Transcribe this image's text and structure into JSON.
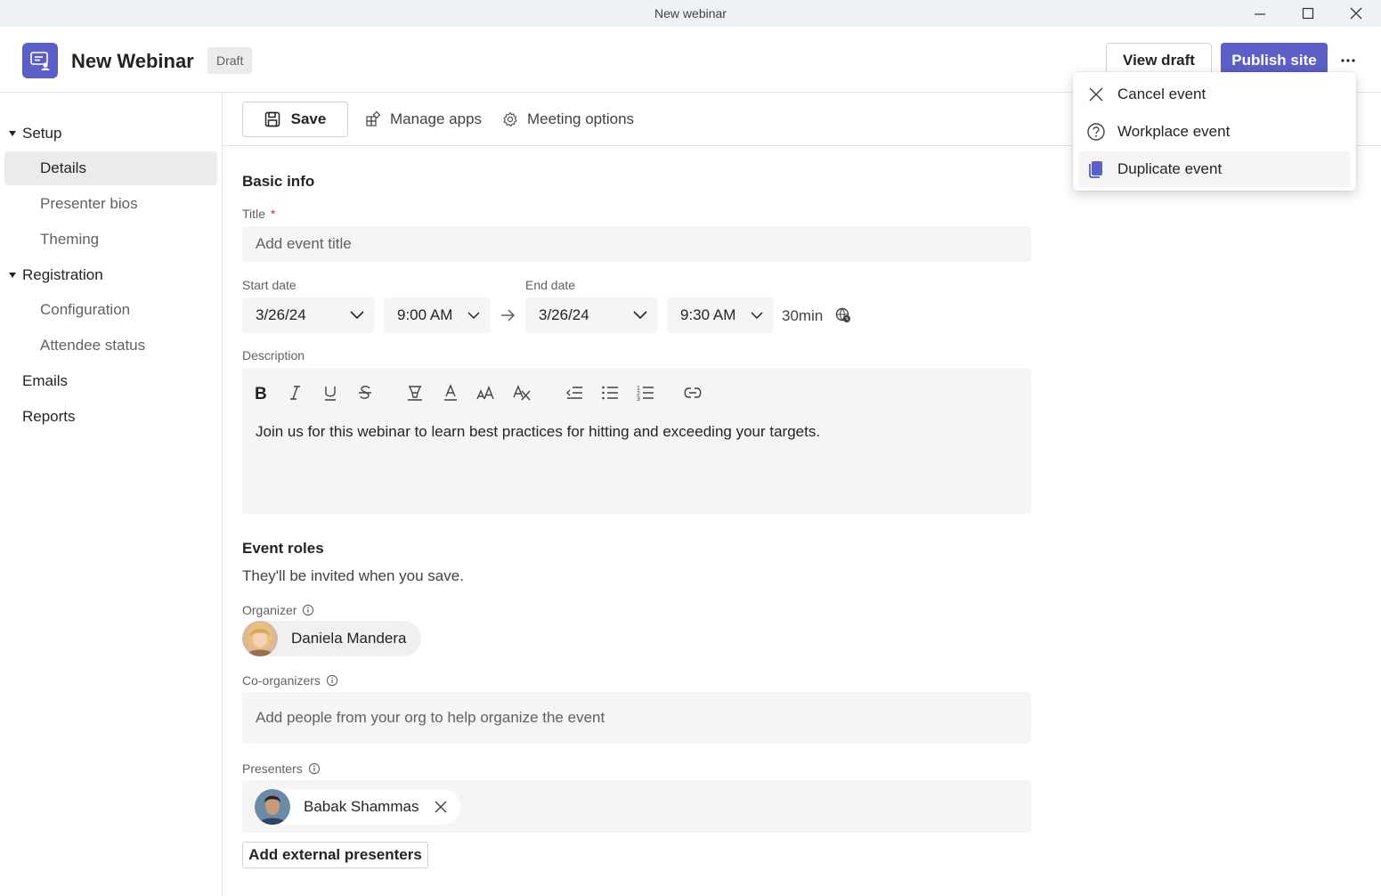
{
  "window": {
    "title": "New webinar"
  },
  "header": {
    "app_title": "New Webinar",
    "status_badge": "Draft",
    "view_draft_label": "View draft",
    "publish_label": "Publish site",
    "brand_color": "#5b5fc7"
  },
  "sidebar": {
    "setup": {
      "label": "Setup",
      "items": [
        "Details",
        "Presenter bios",
        "Theming"
      ],
      "selected": "Details"
    },
    "registration": {
      "label": "Registration",
      "items": [
        "Configuration",
        "Attendee status"
      ]
    },
    "emails": "Emails",
    "reports": "Reports"
  },
  "toolbar": {
    "save_label": "Save",
    "manage_apps_label": "Manage apps",
    "meeting_options_label": "Meeting options"
  },
  "form": {
    "basic_info_heading": "Basic info",
    "title_label": "Title",
    "required_marker": "*",
    "title_placeholder": "Add event title",
    "start_date_label": "Start date",
    "start_date": "3/26/24",
    "start_time": "9:00 AM",
    "end_date_label": "End date",
    "end_date": "3/26/24",
    "end_time": "9:30 AM",
    "duration": "30min",
    "description_label": "Description",
    "description_text": "Join us for this webinar to learn best practices for hitting and exceeding your targets.",
    "event_roles_heading": "Event roles",
    "event_roles_subtitle": "They'll be invited when you save.",
    "organizer_label": "Organizer",
    "organizer_name": "Daniela Mandera",
    "coorganizers_label": "Co-organizers",
    "coorganizers_placeholder": "Add people from your org to help organize the event",
    "presenters_label": "Presenters",
    "presenter_name": "Babak Shammas",
    "add_external_label": "Add external presenters"
  },
  "more_menu": {
    "items": [
      {
        "label": "Cancel event",
        "icon": "close-icon"
      },
      {
        "label": "Workplace event",
        "icon": "question-circle-icon"
      },
      {
        "label": "Duplicate event",
        "icon": "duplicate-icon",
        "highlighted": true
      }
    ]
  }
}
